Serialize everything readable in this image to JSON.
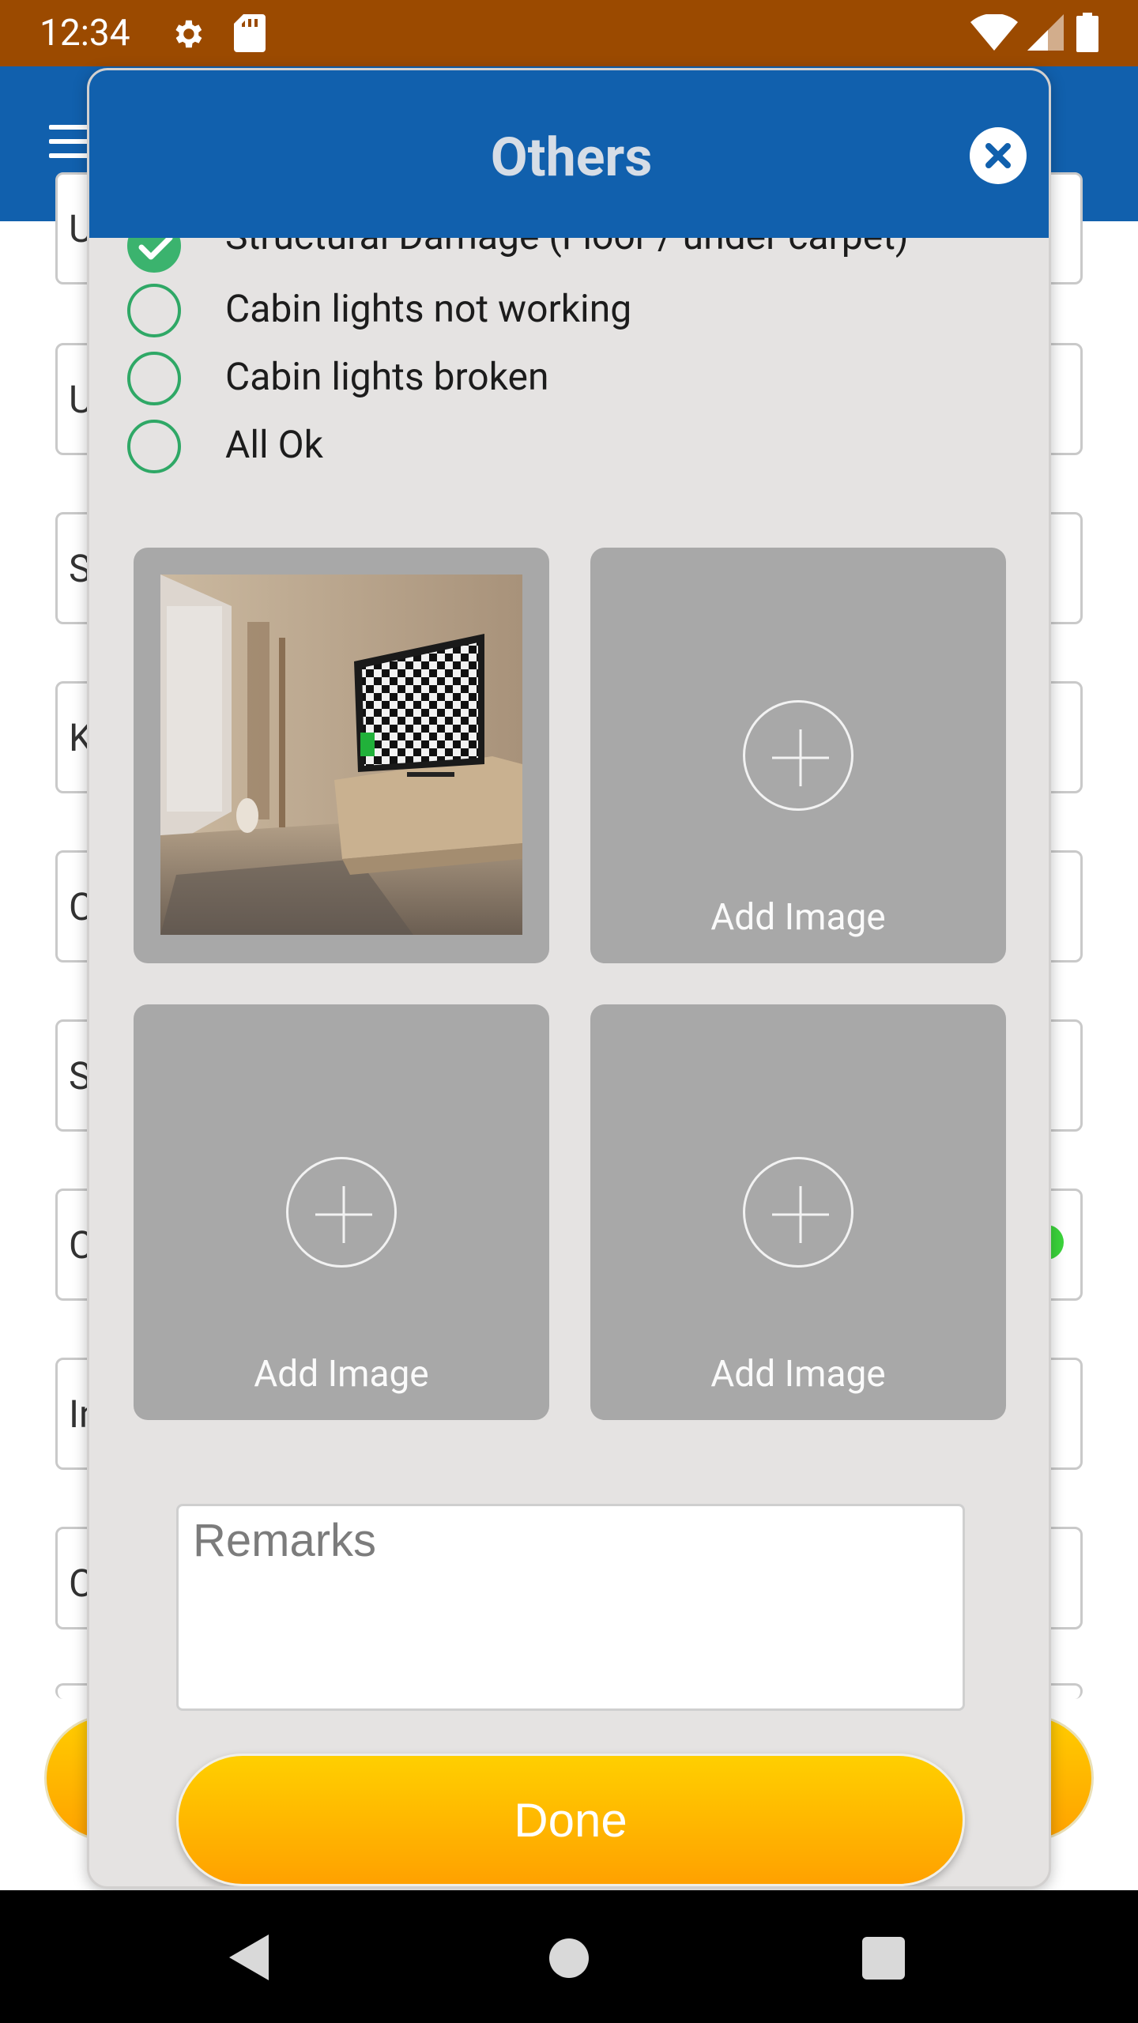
{
  "status_bar": {
    "time": "12:34",
    "icons": [
      "settings-gear-icon",
      "sd-card-icon",
      "wifi-icon",
      "cell-signal-icon",
      "battery-icon"
    ]
  },
  "background": {
    "field_initials": [
      "U",
      "U",
      "S",
      "K",
      "C",
      "S",
      "C",
      "In",
      "C"
    ]
  },
  "modal": {
    "title": "Others",
    "options": [
      {
        "label": "Structural Damage (Floor / under carpet)",
        "checked": true
      },
      {
        "label": "Cabin lights not working",
        "checked": false
      },
      {
        "label": "Cabin lights broken",
        "checked": false
      },
      {
        "label": "All Ok",
        "checked": false
      }
    ],
    "image_tiles": [
      {
        "type": "photo",
        "description": "living-room-photo"
      },
      {
        "type": "add",
        "label": "Add Image"
      },
      {
        "type": "add",
        "label": "Add Image"
      },
      {
        "type": "add",
        "label": "Add Image"
      }
    ],
    "remarks": {
      "placeholder": "Remarks",
      "value": ""
    },
    "done_label": "Done"
  },
  "colors": {
    "status_bar": "#9b4a00",
    "header_blue": "#1160ad",
    "check_green": "#3bb36e",
    "done_yellow": "#ffb800",
    "tile_gray": "#a8a8a8",
    "modal_bg": "#e5e3e2"
  }
}
